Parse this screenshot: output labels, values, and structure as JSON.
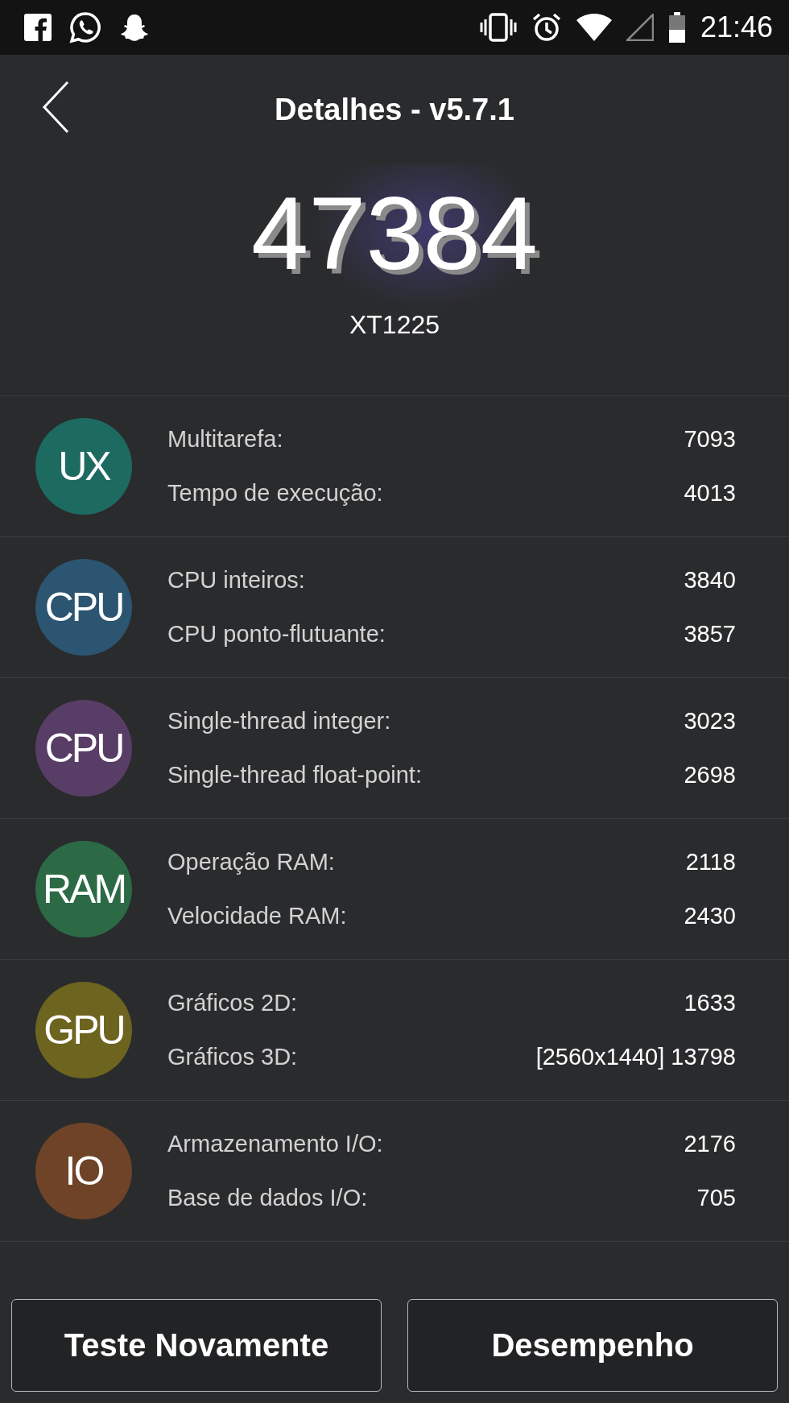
{
  "status_bar": {
    "time": "21:46"
  },
  "header": {
    "title": "Detalhes - v5.7.1"
  },
  "score": {
    "total": "47384",
    "device": "XT1225"
  },
  "categories": [
    {
      "badge": "UX",
      "color": "#1d6a61",
      "items": [
        {
          "label": "Multitarefa:",
          "value": "7093"
        },
        {
          "label": "Tempo de execução:",
          "value": "4013"
        }
      ]
    },
    {
      "badge": "CPU",
      "color": "#2b5570",
      "items": [
        {
          "label": "CPU inteiros:",
          "value": "3840"
        },
        {
          "label": "CPU ponto-flutuante:",
          "value": "3857"
        }
      ]
    },
    {
      "badge": "CPU",
      "color": "#583d66",
      "items": [
        {
          "label": "Single-thread integer:",
          "value": "3023"
        },
        {
          "label": "Single-thread float-point:",
          "value": "2698"
        }
      ]
    },
    {
      "badge": "RAM",
      "color": "#2b6a45",
      "items": [
        {
          "label": "Operação RAM:",
          "value": "2118"
        },
        {
          "label": "Velocidade RAM:",
          "value": "2430"
        }
      ]
    },
    {
      "badge": "GPU",
      "color": "#6d6420",
      "items": [
        {
          "label": "Gráficos 2D:",
          "value": "1633"
        },
        {
          "label": "Gráficos 3D:",
          "value": "[2560x1440] 13798"
        }
      ]
    },
    {
      "badge": "IO",
      "color": "#6e4328",
      "items": [
        {
          "label": "Armazenamento I/O:",
          "value": "2176"
        },
        {
          "label": "Base de dados I/O:",
          "value": "705"
        }
      ]
    }
  ],
  "buttons": [
    "Teste Novamente",
    "Desempenho"
  ]
}
